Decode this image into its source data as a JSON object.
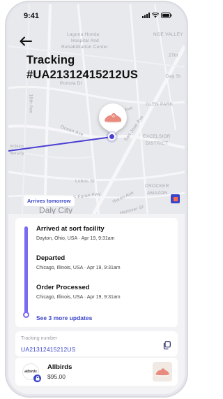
{
  "status_bar": {
    "time": "9:41"
  },
  "header": {
    "title_line1": "Tracking",
    "title_line2": "#UA21312415212US"
  },
  "map": {
    "labels": {
      "laguna": "Laguna Honda",
      "hospital": "Hospital And",
      "rehab": "Rehabilitation Center",
      "noe_valley": "NOE VALLEY",
      "portola": "Portola Dr",
      "st27": "27th",
      "day": "Day St",
      "glen_park": "GLEN PARK",
      "ave19": "19th Ave",
      "ocean_ave": "Ocean Ave",
      "san_jose_ave": "San Jose Ave",
      "excelsior": "EXCELSIOR",
      "district": "DISTRICT",
      "sco": "ncisco",
      "versity": "versity",
      "lobos": "Lobos St",
      "forden": "John F Foran Fwy",
      "hurontale": "Huron Ave",
      "crocker": "CROCKER",
      "amazon": "AMAZON",
      "hanover": "Hanover St",
      "daly_city": "Daly City",
      "front_ave": "Front Ave"
    },
    "arrives_badge": "Arrives tomorrow"
  },
  "updates": {
    "events": [
      {
        "title": "Arrived at sort facility",
        "subtitle": "Dayton, Ohio, USA · Apr 19, 9:31am"
      },
      {
        "title": "Departed",
        "subtitle": "Chicago, Illinois, USA · Apr 19, 9:31am"
      },
      {
        "title": "Order Processed",
        "subtitle": "Chicago, Illinois, USA · Apr 19, 9:31am"
      }
    ],
    "see_more": "See 3 more updates"
  },
  "tracking": {
    "label": "Tracking number",
    "number": "UA21312415212US"
  },
  "product": {
    "brand_logo_text": "allbirds",
    "name": "Allbirds",
    "price": "$95.00"
  },
  "colors": {
    "accent": "#3b45c8",
    "timeline": "#7a6cf2",
    "route": "#4a3fd1"
  },
  "icons": [
    "back-arrow-icon",
    "signal-icon",
    "wifi-icon",
    "battery-icon",
    "copy-icon",
    "lock-icon",
    "shoe-icon",
    "map-layer-icon"
  ]
}
